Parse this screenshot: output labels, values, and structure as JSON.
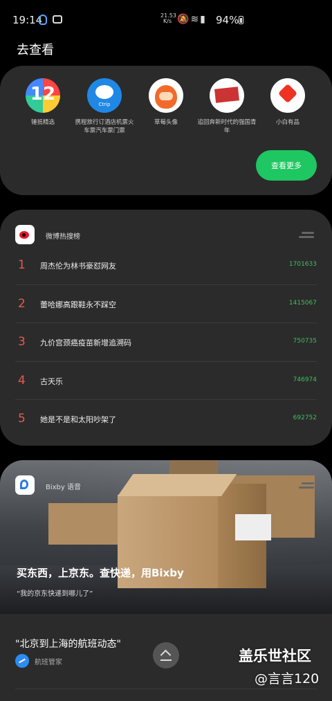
{
  "status_bar": {
    "time": "19:14",
    "net_speed_value": "21.53",
    "net_speed_unit": "K/s",
    "icons": [
      "qq-icon",
      "bilibili-icon",
      "mute-icon",
      "wifi-icon",
      "4g-signal-icon",
      "battery-icon"
    ],
    "battery": "94%"
  },
  "section_title": "去查看",
  "apps": [
    {
      "label": "锤抵精选",
      "icon": "12-icon"
    },
    {
      "label": "携程旅行订酒店机票火车票汽车票门票",
      "icon": "ctrip-icon"
    },
    {
      "label": "草莓头像",
      "icon": "strawberry-avatar-icon"
    },
    {
      "label": "追回奔新时代的强国青年",
      "icon": "youth-rally-icon"
    },
    {
      "label": "小白有品",
      "icon": "xiaobai-icon"
    }
  ],
  "more_button": "查看更多",
  "weibo": {
    "title": "微博热搜榜",
    "items": [
      {
        "rank": "1",
        "topic": "周杰伦为林书豪怼网友",
        "count": "1701633"
      },
      {
        "rank": "2",
        "topic": "蕾哈娜高跟鞋永不踩空",
        "count": "1415067"
      },
      {
        "rank": "3",
        "topic": "九价宫颈癌疫苗新增追溯码",
        "count": "750735"
      },
      {
        "rank": "4",
        "topic": "古天乐",
        "count": "746974"
      },
      {
        "rank": "5",
        "topic": "她是不是和太阳吵架了",
        "count": "692752"
      }
    ]
  },
  "bixby": {
    "title": "Bixby 语音",
    "banner_title": "买东西，上京东。查快递，用Bixby",
    "banner_sub": "“我的京东快递到哪儿了”",
    "query": "\"北京到上海的航班动态\"",
    "source": "航班管家"
  },
  "watermark": {
    "line1": "盖乐世社区",
    "line2": "@言言120"
  }
}
